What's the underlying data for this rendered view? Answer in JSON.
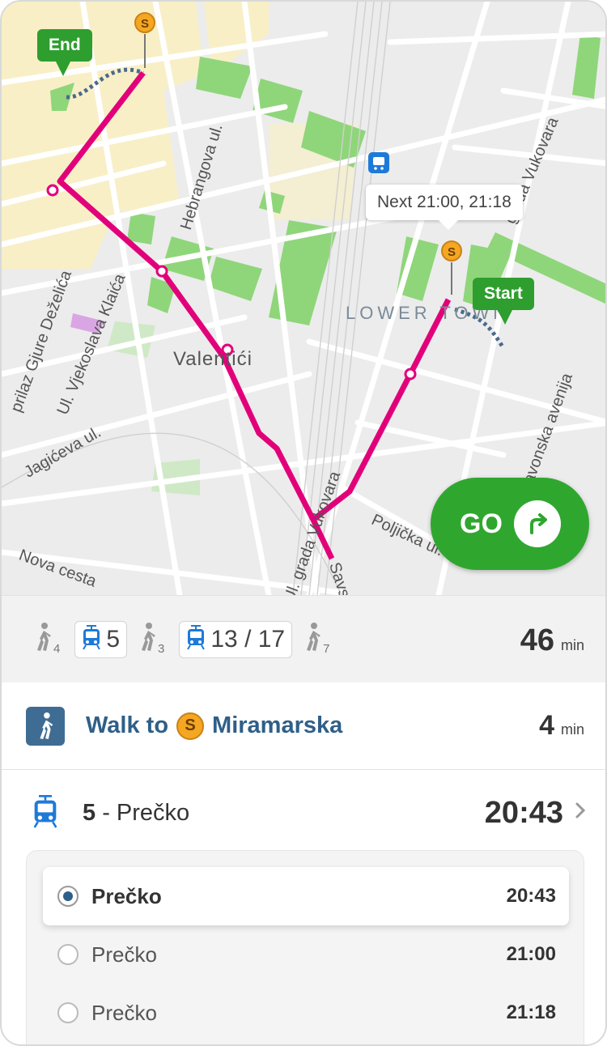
{
  "map": {
    "labels": {
      "hebrangova": "Hebrangova ul.",
      "gjure": "prilaz Gjure Deželića",
      "vjekoslava": "Ul. Vjekoslava Klaića",
      "jagiceva": "Jagićeva ul.",
      "valentici": "Valentići",
      "lower_town": "LOWER TOWN",
      "vukovara_top": "grada Vukovara",
      "slavonska": "Slavonska avenija",
      "poljicka": "Poljička ul.",
      "nova_cesta": "Nova cesta",
      "vukovara_bottom": "Ul. grada Vukovara",
      "savska": "Savska"
    },
    "end_flag": "End",
    "start_flag": "Start",
    "tooltip": "Next 21:00, 21:18",
    "stop_symbol": "S",
    "go_label": "GO",
    "route_color": "#e2007a"
  },
  "summary": {
    "legs": [
      {
        "type": "walk",
        "minutes": "4"
      },
      {
        "type": "tram",
        "line": "5"
      },
      {
        "type": "walk",
        "minutes": "3"
      },
      {
        "type": "tram",
        "line": "13 / 17"
      },
      {
        "type": "walk",
        "minutes": "7"
      }
    ],
    "total": "46",
    "unit": "min"
  },
  "walk_step": {
    "prefix": "Walk to",
    "stop": "Miramarska",
    "minutes": "4",
    "unit": "min"
  },
  "tram_step": {
    "line": "5",
    "separator": " - ",
    "destination": "Prečko",
    "time": "20:43"
  },
  "departures": [
    {
      "name": "Prečko",
      "time": "20:43",
      "selected": true
    },
    {
      "name": "Prečko",
      "time": "21:00",
      "selected": false
    },
    {
      "name": "Prečko",
      "time": "21:18",
      "selected": false
    }
  ]
}
